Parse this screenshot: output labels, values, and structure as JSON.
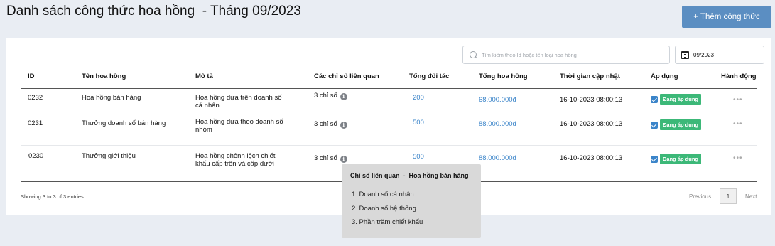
{
  "page": {
    "title": "Danh sách công thức hoa hồng  - Tháng 09/2023",
    "add_button": "+ Thêm công thức"
  },
  "toolbar": {
    "search_placeholder": "Tìm kiếm theo Id hoặc tên loại hoa hồng",
    "date_value": "09/2023"
  },
  "table": {
    "headers": [
      "ID",
      "Tên hoa hồng",
      "Mô tả",
      "Các chỉ số liên quan",
      "Tổng đối tác",
      "Tổng hoa hồng",
      "Thời gian cập nhật",
      "Áp dụng",
      "Hành động"
    ],
    "rows": [
      {
        "id": "0232",
        "name": "Hoa hồng bán hàng",
        "description": "Hoa hồng dựa trên doanh số cá nhân",
        "metrics": "3 chỉ số",
        "partners": "200",
        "commission": "68.000.000đ",
        "updated": "16-10-2023 08:00:13",
        "status": "Đang áp dụng",
        "actions": "•••"
      },
      {
        "id": "0231",
        "name": "Thưởng doanh số bán hàng",
        "description": "Hoa hồng dựa theo doanh số nhóm",
        "metrics": "3 chỉ số",
        "partners": "500",
        "commission": "88.000.000đ",
        "updated": "16-10-2023 08:00:13",
        "status": "Đang áp dụng",
        "actions": "•••"
      },
      {
        "id": "0230",
        "name": "Thưởng giới thiệu",
        "description": "Hoa hồng chênh lệch chiết khấu cấp trên và cấp dưới",
        "metrics": "3 chỉ số",
        "partners": "500",
        "commission": "88.000.000đ",
        "updated": "16-10-2023 08:00:13",
        "status": "Đang áp dụng",
        "actions": "•••"
      }
    ]
  },
  "footer": {
    "showing": "Showing 3 to 3 of 3 entries",
    "previous": "Previous",
    "page": "1",
    "next": "Next"
  },
  "tooltip": {
    "title": "Chỉ số liên quan  -  Hoa hồng bán hàng",
    "items": [
      "1. Doanh số cá nhân",
      "2. Doanh số hệ thống",
      "3. Phần trăm chiết khấu"
    ]
  },
  "colors": {
    "accent": "#5b8ec2",
    "link": "#3a84c9",
    "badge": "#3cb878",
    "background": "#e9edf3"
  }
}
